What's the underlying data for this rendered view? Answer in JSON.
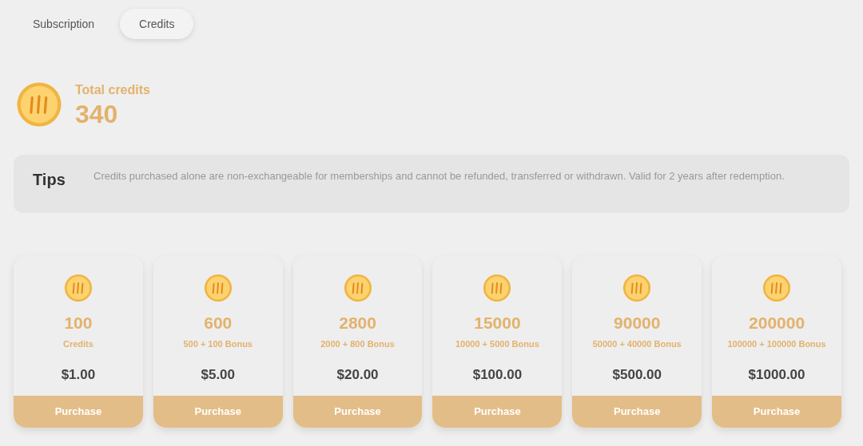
{
  "tabs": [
    {
      "label": "Subscription",
      "selected": false
    },
    {
      "label": "Credits",
      "selected": true
    }
  ],
  "balance": {
    "label": "Total credits",
    "value": "340"
  },
  "tips": {
    "title": "Tips",
    "text": "Credits purchased alone are non-exchangeable for memberships and cannot be refunded, transferred or withdrawn. Valid for 2 years after redemption."
  },
  "packages": [
    {
      "amount": "100",
      "detail": "Credits",
      "price": "$1.00",
      "button": "Purchase"
    },
    {
      "amount": "600",
      "detail": "500 + 100 Bonus",
      "price": "$5.00",
      "button": "Purchase"
    },
    {
      "amount": "2800",
      "detail": "2000 + 800 Bonus",
      "price": "$20.00",
      "button": "Purchase"
    },
    {
      "amount": "15000",
      "detail": "10000 + 5000 Bonus",
      "price": "$100.00",
      "button": "Purchase"
    },
    {
      "amount": "90000",
      "detail": "50000 + 40000 Bonus",
      "price": "$500.00",
      "button": "Purchase"
    },
    {
      "amount": "200000",
      "detail": "100000 + 100000 Bonus",
      "price": "$1000.00",
      "button": "Purchase"
    }
  ]
}
